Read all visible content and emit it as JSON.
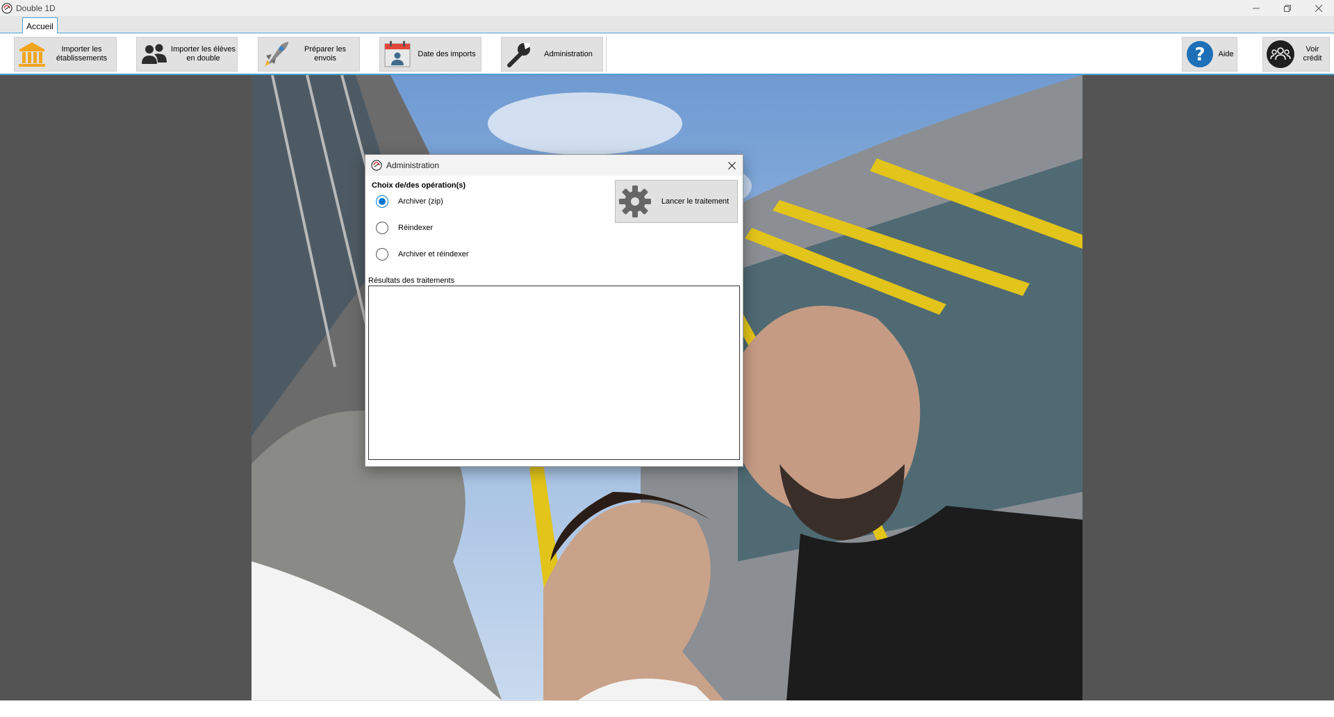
{
  "window": {
    "title": "Double 1D",
    "controls": [
      "minimize-icon",
      "restore-icon",
      "close-icon"
    ]
  },
  "ribbon": {
    "tabs": [
      {
        "label": "Accueil",
        "active": true
      }
    ],
    "buttons": [
      {
        "label": "Importer les\nétablissements",
        "icon": "institution-icon"
      },
      {
        "label": "Importer les élèves\nen double",
        "icon": "users-icon"
      },
      {
        "label": "Préparer les envois",
        "icon": "rocket-icon"
      },
      {
        "label": "Date des imports",
        "icon": "calendar-person-icon"
      },
      {
        "label": "Administration",
        "icon": "wrench-icon"
      },
      {
        "label": "Aide",
        "icon": "help-icon"
      },
      {
        "label": "Voir crédit",
        "icon": "team-icon"
      }
    ]
  },
  "dialog": {
    "title": "Administration",
    "section_title": "Choix de/des opération(s)",
    "options": [
      {
        "label": "Archiver (zip)",
        "checked": true
      },
      {
        "label": "Réindexer",
        "checked": false
      },
      {
        "label": "Archiver et réindexer",
        "checked": false
      }
    ],
    "run_button_label": "Lancer le traitement",
    "results_label": "Résultats des traitements",
    "results_text": ""
  },
  "colors": {
    "accent": "#4aa3d6",
    "radio_checked": "#0078d4",
    "background": "#545454"
  }
}
